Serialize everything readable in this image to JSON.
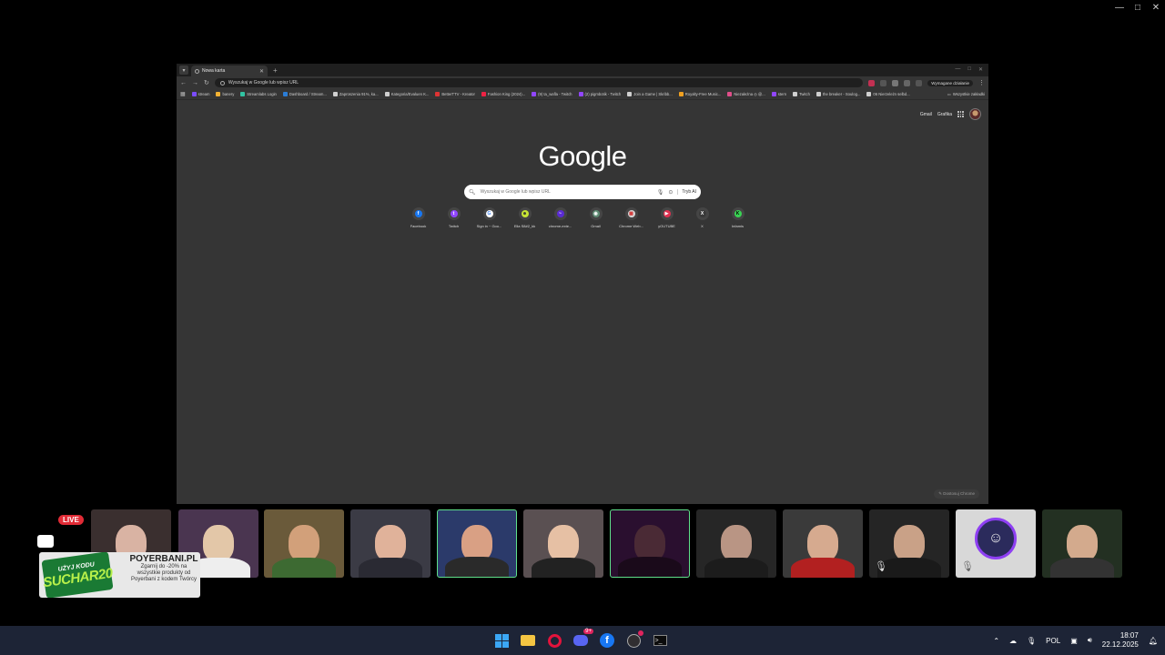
{
  "browser": {
    "tab_title": "Nowa karta",
    "omnibox_placeholder": "Wyszukaj w Google lub wpisz URL",
    "ai_mode_button": "Wymagane działanie",
    "bookmarks": [
      {
        "label": "stream",
        "color": "#7b4cff"
      },
      {
        "label": "banery",
        "color": "#f2b233"
      },
      {
        "label": "Streamlabs Login",
        "color": "#31c3a2"
      },
      {
        "label": "Dashboard / Stream...",
        "color": "#2b7dd6"
      },
      {
        "label": "Zaproszenia 91%, ka...",
        "color": "#cfcfcf"
      },
      {
        "label": "Kategoria/Evaluen K...",
        "color": "#cfcfcf"
      },
      {
        "label": "BetterTTV - Kreator",
        "color": "#d33"
      },
      {
        "label": "Fashion King (2024)...",
        "color": "#e24"
      },
      {
        "label": "(9) ta_wafla - Twitch",
        "color": "#9146ff"
      },
      {
        "label": "(2) pigmbotik - Twitch",
        "color": "#9146ff"
      },
      {
        "label": "Join a Game | Skribb...",
        "color": "#cfcfcf"
      },
      {
        "label": "Royalty-Free Music...",
        "color": "#f0a020"
      },
      {
        "label": "Niezależna ◎ @...",
        "color": "#e04e8a"
      },
      {
        "label": "stern",
        "color": "#9146ff"
      },
      {
        "label": "Twitch",
        "color": "#cfcfcf"
      },
      {
        "label": "the breaker - Soulog...",
        "color": "#cfcfcf"
      },
      {
        "label": "06 Nierzeleżn selbd...",
        "color": "#cfcfcf"
      }
    ],
    "all_bookmarks": "Wszystkie zakładki",
    "winctl": [
      "—",
      "□",
      "✕"
    ]
  },
  "ntp": {
    "gmail": "Gmail",
    "grafika": "Grafika",
    "logo": "Google",
    "search_placeholder": "Wyszukaj w Google lub wpisz URL",
    "ai_mode": "Tryb AI",
    "shortcuts": [
      {
        "label": "Facebook",
        "icon": "f",
        "bg": "#1877f2",
        "fg": "#ffffff"
      },
      {
        "label": "Twitch",
        "icon": "t",
        "bg": "#9146ff",
        "fg": "#ffffff"
      },
      {
        "label": "Sign in ~ Goo...",
        "icon": "G",
        "bg": "#ffffff",
        "fg": "#4285f4"
      },
      {
        "label": "Ella S8#2_kk",
        "icon": "☻",
        "bg": "#c8e635",
        "fg": "#333333"
      },
      {
        "label": "chrome-exte...",
        "icon": "~",
        "bg": "#5b2bd4",
        "fg": "#ffffff"
      },
      {
        "label": "Gmail",
        "icon": "◉",
        "bg": "#5d8a72",
        "fg": "#ffffff"
      },
      {
        "label": "Chrome Web...",
        "icon": "▦",
        "bg": "#d9d9d9",
        "fg": "#d33333"
      },
      {
        "label": "yOUTUBE",
        "icon": "▶",
        "bg": "#e03050",
        "fg": "#ffffff"
      },
      {
        "label": "X",
        "icon": "X",
        "bg": "#3a3a3a",
        "fg": "#ffffff"
      },
      {
        "label": "Infamis",
        "icon": "K",
        "bg": "#39d353",
        "fg": "#000000"
      }
    ],
    "customize": "Dostosuj Chrome"
  },
  "overlay": {
    "live": "LIVE",
    "promo_badge_top": "UŻYJ KODU",
    "promo_badge_code": "SUCHAR20",
    "promo_brand": "POYERBANI.PL",
    "promo_text": "Zgarnij do -20% na wszystkie produkty od Poyerbani z kodem Twórcy"
  },
  "taskbar": {
    "discord_badge": "9+",
    "lang": "POL",
    "time": "18:07",
    "date": "22.12.2025"
  },
  "colors": {
    "accent_speaking": "#5fe08a",
    "taskbar_bg": "#1d2436",
    "live_red": "#e12b36"
  }
}
